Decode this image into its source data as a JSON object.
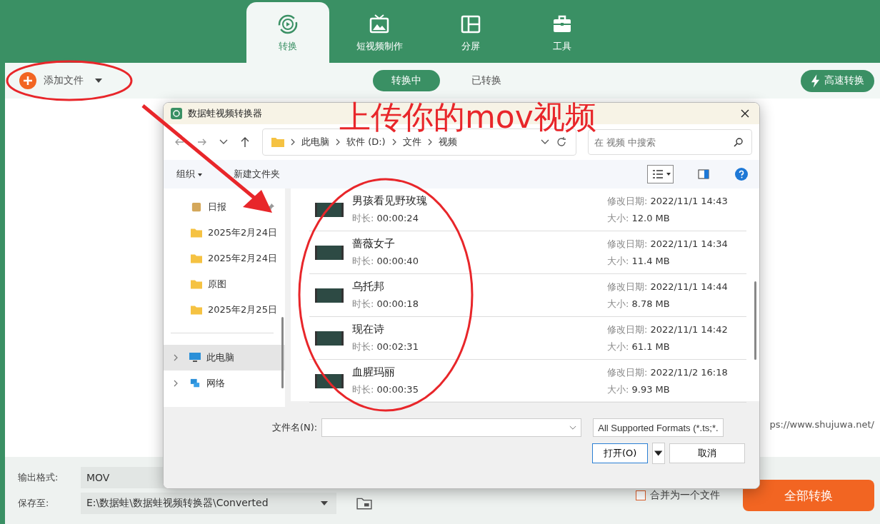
{
  "app": {
    "tabs": [
      {
        "label": "转换",
        "kind": "convert",
        "selected": true
      },
      {
        "label": "短视频制作",
        "kind": "video",
        "selected": false
      },
      {
        "label": "分屏",
        "kind": "split",
        "selected": false
      },
      {
        "label": "工具",
        "kind": "tools",
        "selected": false
      }
    ],
    "add_file": "添加文件",
    "status_tabs": [
      {
        "label": "转换中",
        "selected": true
      },
      {
        "label": "已转换",
        "selected": false
      }
    ],
    "fast_convert": "高速转换",
    "link": "ps://www.shujuwa.net/",
    "format_label": "输出格式:",
    "format_value": "MOV",
    "save_label": "保存至:",
    "save_path": "E:\\数据蛙\\数据蛙视频转换器\\Converted",
    "merge": {
      "label": "合并为一个文件",
      "checked": false
    },
    "convert_all": "全部转换"
  },
  "dialog": {
    "title": "数据蛙视频转换器",
    "path": [
      "此电脑",
      "软件 (D:)",
      "文件",
      "视频"
    ],
    "search": {
      "placeholder": "在 视频 中搜索"
    },
    "organize": "组织",
    "new_folder": "新建文件夹",
    "sidebar": [
      {
        "label": "日报",
        "kind": "doc",
        "pinned": true,
        "selected": false
      },
      {
        "label": "2025年2月24日",
        "kind": "folder",
        "pinned": false,
        "selected": false
      },
      {
        "label": "2025年2月24日",
        "kind": "folder",
        "pinned": false,
        "selected": false
      },
      {
        "label": "原图",
        "kind": "folder",
        "pinned": false,
        "selected": false
      },
      {
        "label": "2025年2月25日",
        "kind": "folder",
        "pinned": false,
        "selected": false
      },
      {
        "label": "此电脑",
        "kind": "computer",
        "pinned": false,
        "selected": true
      },
      {
        "label": "网络",
        "kind": "network",
        "pinned": false,
        "selected": false
      }
    ],
    "files": [
      {
        "name": "男孩看见野玫瑰",
        "duration_label": "时长:",
        "duration": "00:00:24",
        "modified_label": "修改日期:",
        "modified": "2022/11/1 14:43",
        "size_label": "大小:",
        "size": "12.0 MB"
      },
      {
        "name": "蔷薇女子",
        "duration_label": "时长:",
        "duration": "00:00:40",
        "modified_label": "修改日期:",
        "modified": "2022/11/1 14:34",
        "size_label": "大小:",
        "size": "11.4 MB"
      },
      {
        "name": "乌托邦",
        "duration_label": "时长:",
        "duration": "00:00:18",
        "modified_label": "修改日期:",
        "modified": "2022/11/1 14:44",
        "size_label": "大小:",
        "size": "8.78 MB"
      },
      {
        "name": "现在诗",
        "duration_label": "时长:",
        "duration": "00:02:31",
        "modified_label": "修改日期:",
        "modified": "2022/11/1 14:42",
        "size_label": "大小:",
        "size": "61.1 MB"
      },
      {
        "name": "血腥玛丽",
        "duration_label": "时长:",
        "duration": "00:00:35",
        "modified_label": "修改日期:",
        "modified": "2022/11/2 16:18",
        "size_label": "大小:",
        "size": "9.93 MB"
      }
    ],
    "filename_label": "文件名(N):",
    "filetype": "All Supported Formats (*.ts;*.",
    "open": "打开(O)",
    "cancel": "取消"
  },
  "annotation": {
    "text": "上传你的mov视频"
  }
}
